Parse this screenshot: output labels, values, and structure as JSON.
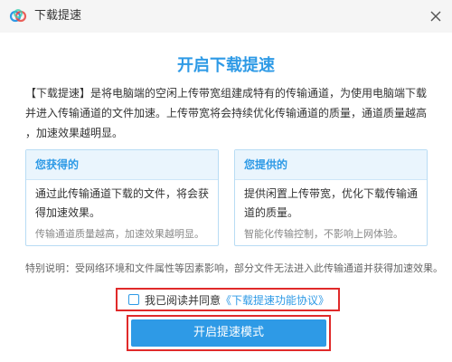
{
  "window": {
    "title": "下载提速",
    "logo_icon": "cloud-logo-icon",
    "close_icon": "close-icon"
  },
  "main": {
    "heading": "开启下载提速",
    "description_lines": [
      "【下载提速】是将电脑端的空闲上传带宽组建成特有的传输通道，为使用电脑端下载",
      "并进入传输通道的文件加速。上传带宽将会持续优化传输通道的质量，通道质量越高",
      "，加速效果越明显。"
    ]
  },
  "cards": [
    {
      "title": "您获得的",
      "body_lines": [
        "通过此传输通道下载的文件，将会获",
        "得加速效果。"
      ],
      "note": "传输通道质量越高，加速效果越明显。"
    },
    {
      "title": "您提供的",
      "body_lines": [
        "提供闲置上传带宽，优化下载传输通",
        "道的质量。"
      ],
      "note": "智能化传输控制，不影响上网体验。"
    }
  ],
  "special_note": "特别说明：受网络环境和文件属性等因素影响，部分文件无法进入此传输通道并获得加速效果。",
  "agreement": {
    "checked": false,
    "label": "我已阅读并同意",
    "link_text": "《下载提速功能协议》"
  },
  "primary_button": {
    "label": "开启提速模式"
  },
  "colors": {
    "accent": "#2e9ae6",
    "highlight_border": "#e02a2a",
    "titlebar_bg": "#f5f5f5",
    "card_header_bg": "#eaf5fd",
    "card_border": "#b8dcf4"
  }
}
